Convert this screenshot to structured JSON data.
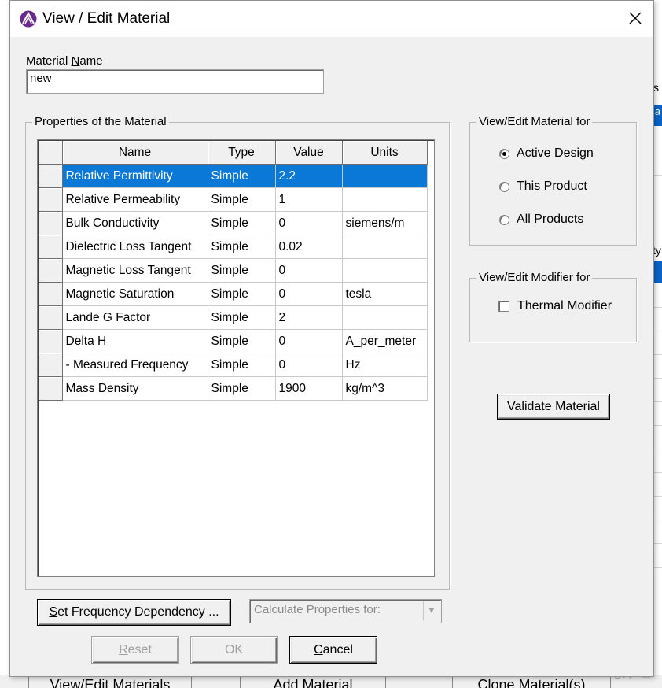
{
  "window": {
    "title": "View / Edit Material"
  },
  "icons": {
    "app": "app-logo-icon",
    "close": "close-icon",
    "dropdown": "chevron-down-icon"
  },
  "colors": {
    "selection": "#0a78d7",
    "background": "#f0f0f0"
  },
  "material_name": {
    "label_pre": "Material ",
    "label_underlined": "N",
    "label_post": "ame",
    "value": "new"
  },
  "properties": {
    "group_title": "Properties of the Material",
    "columns": [
      "Name",
      "Type",
      "Value",
      "Units"
    ],
    "rows": [
      {
        "name": "Relative Permittivity",
        "type": "Simple",
        "value": "2.2",
        "units": ""
      },
      {
        "name": "Relative Permeability",
        "type": "Simple",
        "value": "1",
        "units": ""
      },
      {
        "name": "Bulk Conductivity",
        "type": "Simple",
        "value": "0",
        "units": "siemens/m"
      },
      {
        "name": "Dielectric Loss Tangent",
        "type": "Simple",
        "value": "0.02",
        "units": ""
      },
      {
        "name": "Magnetic Loss Tangent",
        "type": "Simple",
        "value": "0",
        "units": ""
      },
      {
        "name": "Magnetic Saturation",
        "type": "Simple",
        "value": "0",
        "units": "tesla"
      },
      {
        "name": "Lande G Factor",
        "type": "Simple",
        "value": "2",
        "units": ""
      },
      {
        "name": "Delta H",
        "type": "Simple",
        "value": "0",
        "units": "A_per_meter"
      },
      {
        "name": "-  Measured Frequency",
        "type": "Simple",
        "value": "0",
        "units": "Hz"
      },
      {
        "name": "Mass Density",
        "type": "Simple",
        "value": "1900",
        "units": "kg/m^3"
      }
    ],
    "selected_row": 0
  },
  "view_edit_for": {
    "group_title": "View/Edit Material for",
    "options": [
      {
        "label": "Active Design",
        "selected": true
      },
      {
        "label": "This Product",
        "selected": false
      },
      {
        "label": "All Products",
        "selected": false
      }
    ]
  },
  "modifier_for": {
    "group_title": "View/Edit Modifier for",
    "thermal_label": "Thermal Modifier",
    "thermal_checked": false
  },
  "buttons": {
    "validate": "Validate Material",
    "set_freq_u": "S",
    "set_freq_rest": "et Frequency Dependency ...",
    "calc_props": "Calculate Properties for:",
    "reset_u": "R",
    "reset_rest": "eset",
    "ok": "OK",
    "cancel_u": "C",
    "cancel_rest": "ancel"
  },
  "background_app": {
    "bottom_buttons": [
      "View/Edit Materials",
      "Add Material",
      "Clone Material(s)"
    ],
    "side_text_1": "s",
    "side_text_2": "la",
    "side_text_3": "ty"
  },
  "watermark": "CSDN @刘一五"
}
